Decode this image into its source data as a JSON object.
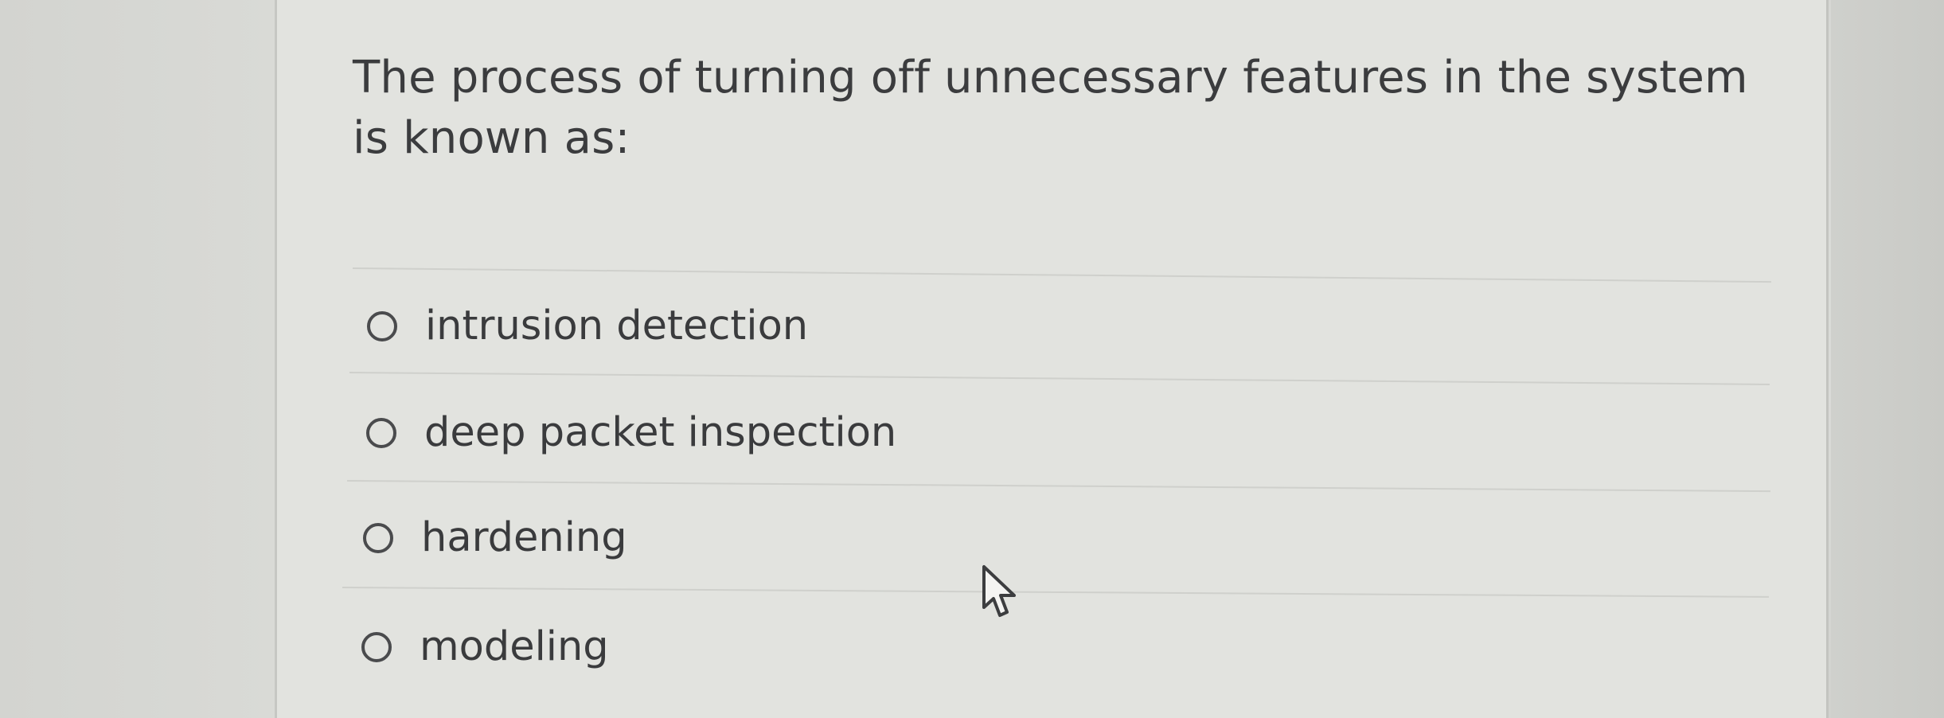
{
  "question": {
    "text": "The process of turning off unnecessary features in the system is known as:"
  },
  "options": [
    {
      "label": "intrusion detection"
    },
    {
      "label": "deep packet inspection"
    },
    {
      "label": "hardening"
    },
    {
      "label": "modeling"
    }
  ],
  "icons": {
    "radio": "radio-button-icon",
    "cursor": "mouse-pointer-icon"
  }
}
